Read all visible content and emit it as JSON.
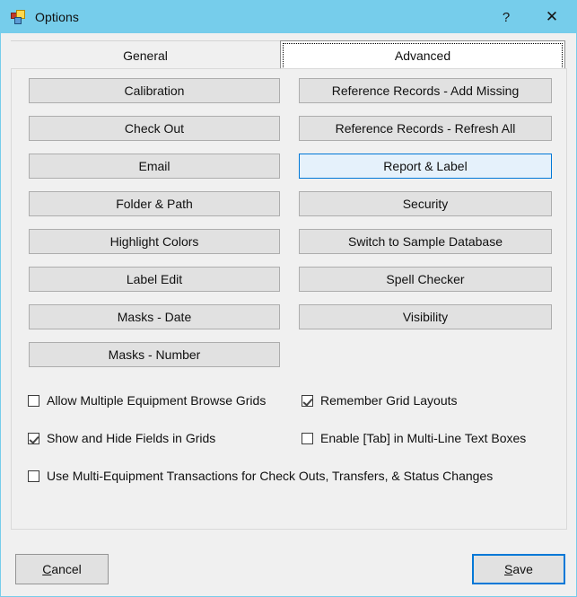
{
  "window": {
    "title": "Options",
    "icon": "app-squares-icon",
    "titlebar_color": "#76cdeb",
    "help_label": "?",
    "close_label": "✕"
  },
  "tabs": [
    {
      "label": "General",
      "selected": false
    },
    {
      "label": "Advanced",
      "selected": true
    }
  ],
  "option_buttons": {
    "left_column": [
      "Calibration",
      "Check Out",
      "Email",
      "Folder & Path",
      "Highlight Colors",
      "Label Edit",
      "Masks - Date",
      "Masks - Number"
    ],
    "right_column": [
      "Reference Records - Add Missing",
      "Reference Records - Refresh All",
      "Report & Label",
      "Security",
      "Switch to Sample Database",
      "Spell Checker",
      "Visibility"
    ],
    "highlighted": "Report & Label",
    "highlight_border_color": "#0078d7",
    "highlight_fill_color": "#e5f1fb"
  },
  "checkboxes": [
    {
      "label": "Allow Multiple Equipment Browse Grids",
      "checked": false
    },
    {
      "label": "Remember Grid Layouts",
      "checked": true
    },
    {
      "label": "Show and Hide Fields in Grids",
      "checked": true
    },
    {
      "label": "Enable [Tab] in Multi-Line Text Boxes",
      "checked": false
    },
    {
      "label": "Use Multi-Equipment Transactions for Check Outs, Transfers, & Status Changes",
      "checked": false
    }
  ],
  "footer": {
    "cancel": {
      "prefix": "",
      "mnemonic": "C",
      "suffix": "ancel",
      "default": false
    },
    "save": {
      "prefix": "",
      "mnemonic": "S",
      "suffix": "ave",
      "default": true,
      "default_border_color": "#0078d7"
    }
  }
}
